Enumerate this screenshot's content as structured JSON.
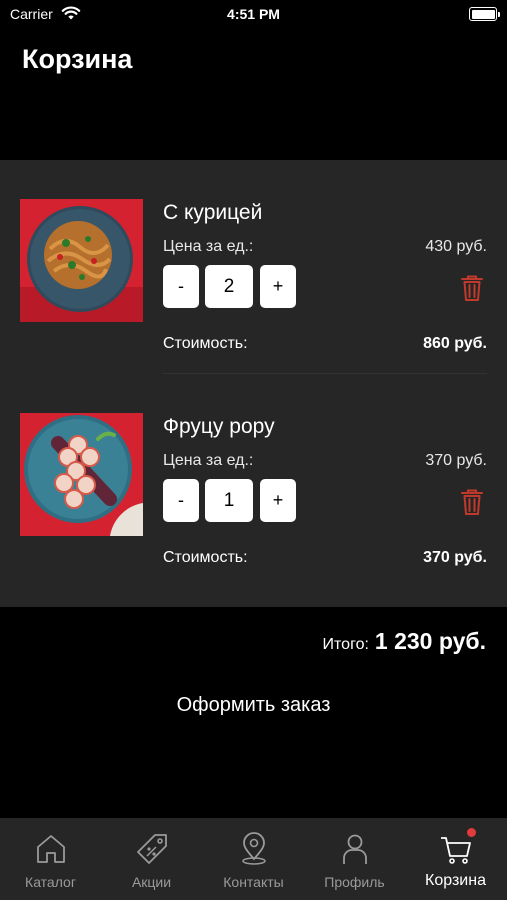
{
  "status_bar": {
    "carrier": "Carrier",
    "time": "4:51 PM"
  },
  "header": {
    "title": "Корзина"
  },
  "cart": {
    "price_label": "Цена за ед.:",
    "cost_label": "Стоимость:",
    "minus_label": "-",
    "plus_label": "+",
    "items": [
      {
        "name": "С курицей",
        "unit_price": "430 руб.",
        "quantity": "2",
        "cost": "860 руб."
      },
      {
        "name": "Фруцу рору",
        "unit_price": "370 руб.",
        "quantity": "1",
        "cost": "370 руб."
      }
    ]
  },
  "summary": {
    "total_label": "Итого:",
    "total_value": "1 230 руб."
  },
  "checkout": {
    "label": "Оформить заказ"
  },
  "tab_bar": {
    "tabs": [
      {
        "label": "Каталог",
        "icon": "home-icon"
      },
      {
        "label": "Акции",
        "icon": "tag-icon"
      },
      {
        "label": "Контакты",
        "icon": "location-pin-icon"
      },
      {
        "label": "Профиль",
        "icon": "user-icon"
      },
      {
        "label": "Корзина",
        "icon": "cart-icon",
        "active": true,
        "badge": true
      }
    ]
  },
  "colors": {
    "background": "#000000",
    "panel": "#262626",
    "trash": "#c0392b",
    "badge": "#e23b3b",
    "tab_inactive": "#9a9a9a"
  }
}
